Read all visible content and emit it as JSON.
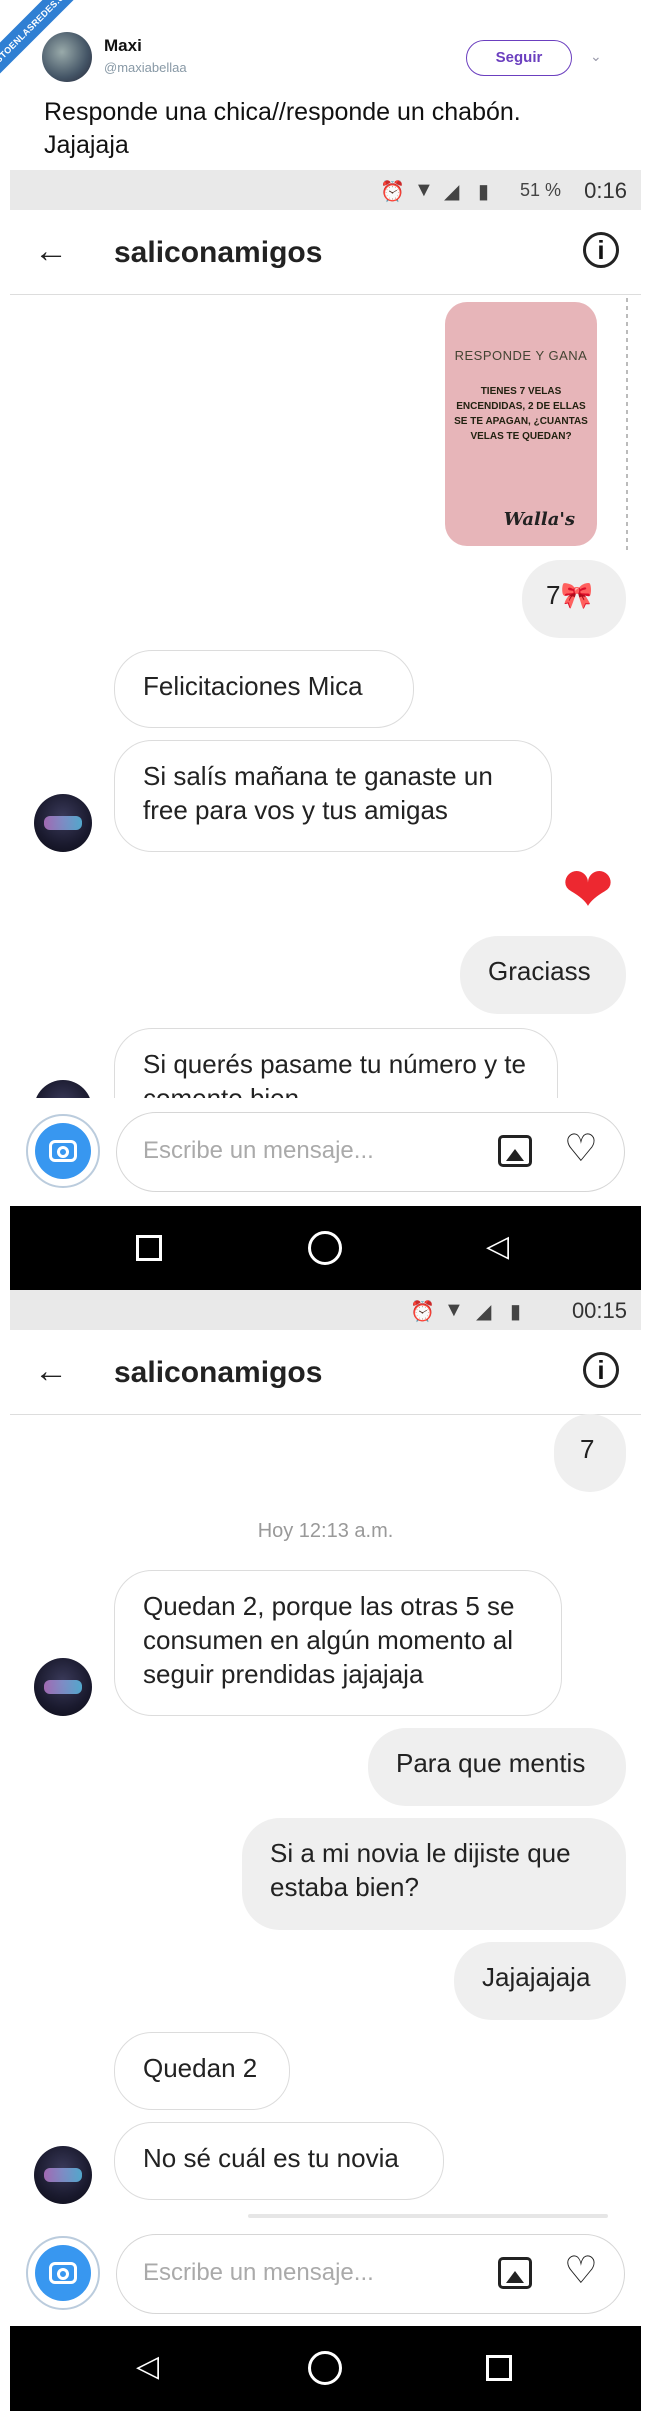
{
  "tweet": {
    "watermark": "VISTOENLASREDES.com",
    "name": "Maxi",
    "handle": "@maxiabellaa",
    "follow_label": "Seguir",
    "text_line1": "Responde una chica//responde un chabón.",
    "text_line2": "Jajajaja"
  },
  "screen1": {
    "status": {
      "battery": "51 %",
      "time": "0:16"
    },
    "chat_title": "saliconamigos",
    "sticker": {
      "title": "RESPONDE Y GANA",
      "question": "TIENES 7 VELAS ENCENDIDAS, 2 DE ELLAS SE TE APAGAN, ¿CUANTAS VELAS TE QUEDAN?",
      "brand": "Walla's"
    },
    "messages": [
      {
        "dir": "out",
        "text": "7🎀"
      },
      {
        "dir": "in",
        "text": "Felicitaciones Mica"
      },
      {
        "dir": "in",
        "text": "Si salís mañana te ganaste un free para vos y tus amigas"
      },
      {
        "dir": "out",
        "text": "Graciass"
      },
      {
        "dir": "in",
        "text": "Si querés pasame tu número y te comento bien"
      }
    ],
    "heart_reaction": "❤",
    "composer_placeholder": "Escribe un mensaje..."
  },
  "screen2": {
    "status": {
      "time": "00:15"
    },
    "chat_title": "saliconamigos",
    "timestamp": "Hoy 12:13 a.m.",
    "messages": [
      {
        "dir": "out",
        "text": "7"
      },
      {
        "dir": "in",
        "text": "Quedan 2, porque las otras 5 se consumen en algún momento al seguir prendidas jajajaja"
      },
      {
        "dir": "out",
        "text": "Para que mentis"
      },
      {
        "dir": "out",
        "text": "Si a mi novia le dijiste que estaba bien?"
      },
      {
        "dir": "out",
        "text": "Jajajajaja"
      },
      {
        "dir": "in",
        "text": "Quedan 2"
      },
      {
        "dir": "in",
        "text": "No sé cuál es tu novia"
      }
    ],
    "composer_placeholder": "Escribe un mensaje..."
  },
  "icons": {
    "back": "arrow-left-icon",
    "info": "info-icon",
    "camera": "camera-icon",
    "gallery": "image-icon",
    "heart": "heart-outline-icon",
    "nav_square": "recent-apps-icon",
    "nav_circle": "home-icon",
    "nav_triangle": "back-triangle-icon"
  }
}
